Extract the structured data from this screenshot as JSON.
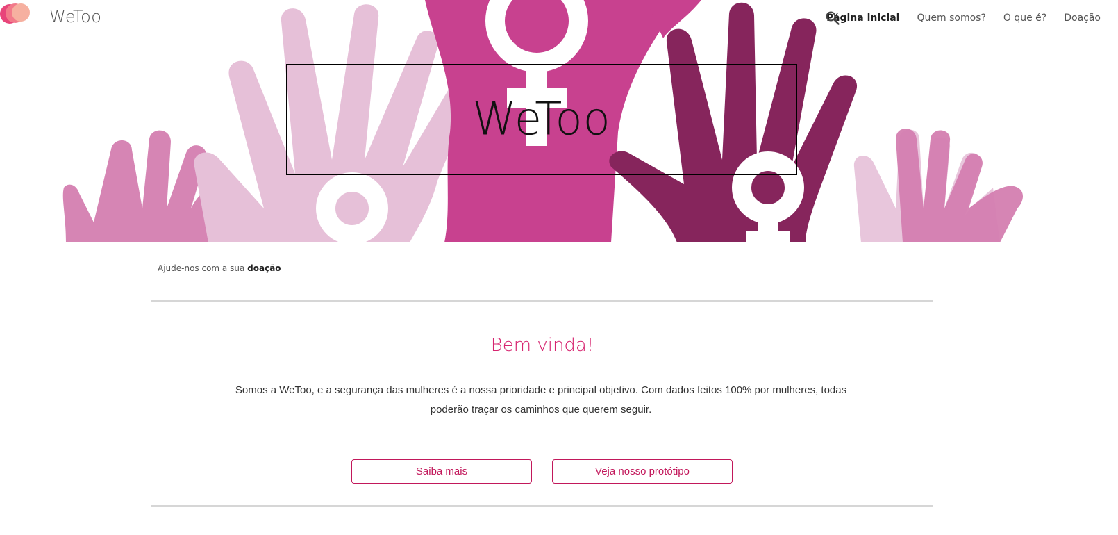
{
  "header": {
    "site_name": "WeToo",
    "logo_icon": "faces-profile-logo-icon",
    "nav": [
      {
        "label": "Página inicial",
        "active": true
      },
      {
        "label": "Quem somos?",
        "active": false
      },
      {
        "label": "O que é?",
        "active": false
      },
      {
        "label": "Doação",
        "active": false
      }
    ],
    "search_icon": "search-icon"
  },
  "hero": {
    "title": "WeToo",
    "image": "raised-hands-female-symbol-illustration",
    "colors": {
      "light_pink": "#e6c0d8",
      "medium_pink": "#d47eb0",
      "magenta": "#c8418f",
      "plum": "#86255c"
    }
  },
  "main": {
    "donate_prefix": "Ajude-nos com a sua",
    "donate_link": "doação",
    "welcome_title": "Bem vinda!",
    "intro_text": "Somos a WeToo, e a segurança das mulheres é a nossa prioridade e principal objetivo. Com dados feitos 100% por mulheres, todas poderão traçar os caminhos que querem seguir.",
    "buttons": {
      "learn_more": "Saiba mais",
      "prototype": "Veja nosso protótipo"
    },
    "accent_color": "#c2185b"
  }
}
